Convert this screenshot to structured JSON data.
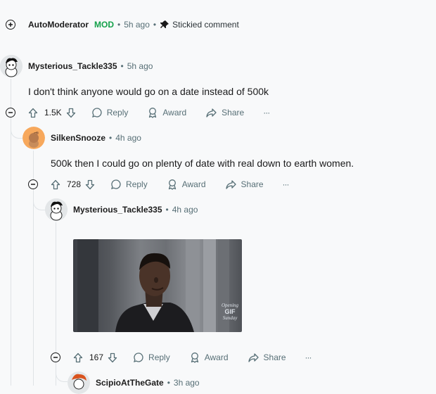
{
  "comments": {
    "automod": {
      "username": "AutoModerator",
      "mod_badge": "MOD",
      "time": "5h ago",
      "stickied_label": "Stickied comment"
    },
    "c1": {
      "username": "Mysterious_Tackle335",
      "time": "5h ago",
      "body": "I don't think anyone would go on a date instead of 500k",
      "votes": "1.5K"
    },
    "c2": {
      "username": "SilkenSnooze",
      "time": "4h ago",
      "body": "500k then I could go on plenty of date with real down to earth women.",
      "votes": "728"
    },
    "c3": {
      "username": "Mysterious_Tackle335",
      "time": "4h ago",
      "gif_watermark_top": "Opening",
      "gif_watermark_mid": "GIF",
      "gif_watermark_bot": "Sunday",
      "votes": "167"
    },
    "c4": {
      "username": "ScipioAtTheGate",
      "time": "3h ago"
    }
  },
  "actions": {
    "reply": "Reply",
    "award": "Award",
    "share": "Share",
    "more": "···"
  },
  "icons": {
    "expand": "plus-circle-icon",
    "collapse": "minus-circle-icon",
    "pin": "pin-icon",
    "upvote": "upvote-arrow-icon",
    "downvote": "downvote-arrow-icon",
    "reply": "speech-bubble-icon",
    "award": "award-ribbon-icon",
    "share": "share-arrow-icon"
  },
  "colors": {
    "mod_green": "#14a14a",
    "meta_gray": "#576f76",
    "thread_line": "#dfe3e6"
  }
}
